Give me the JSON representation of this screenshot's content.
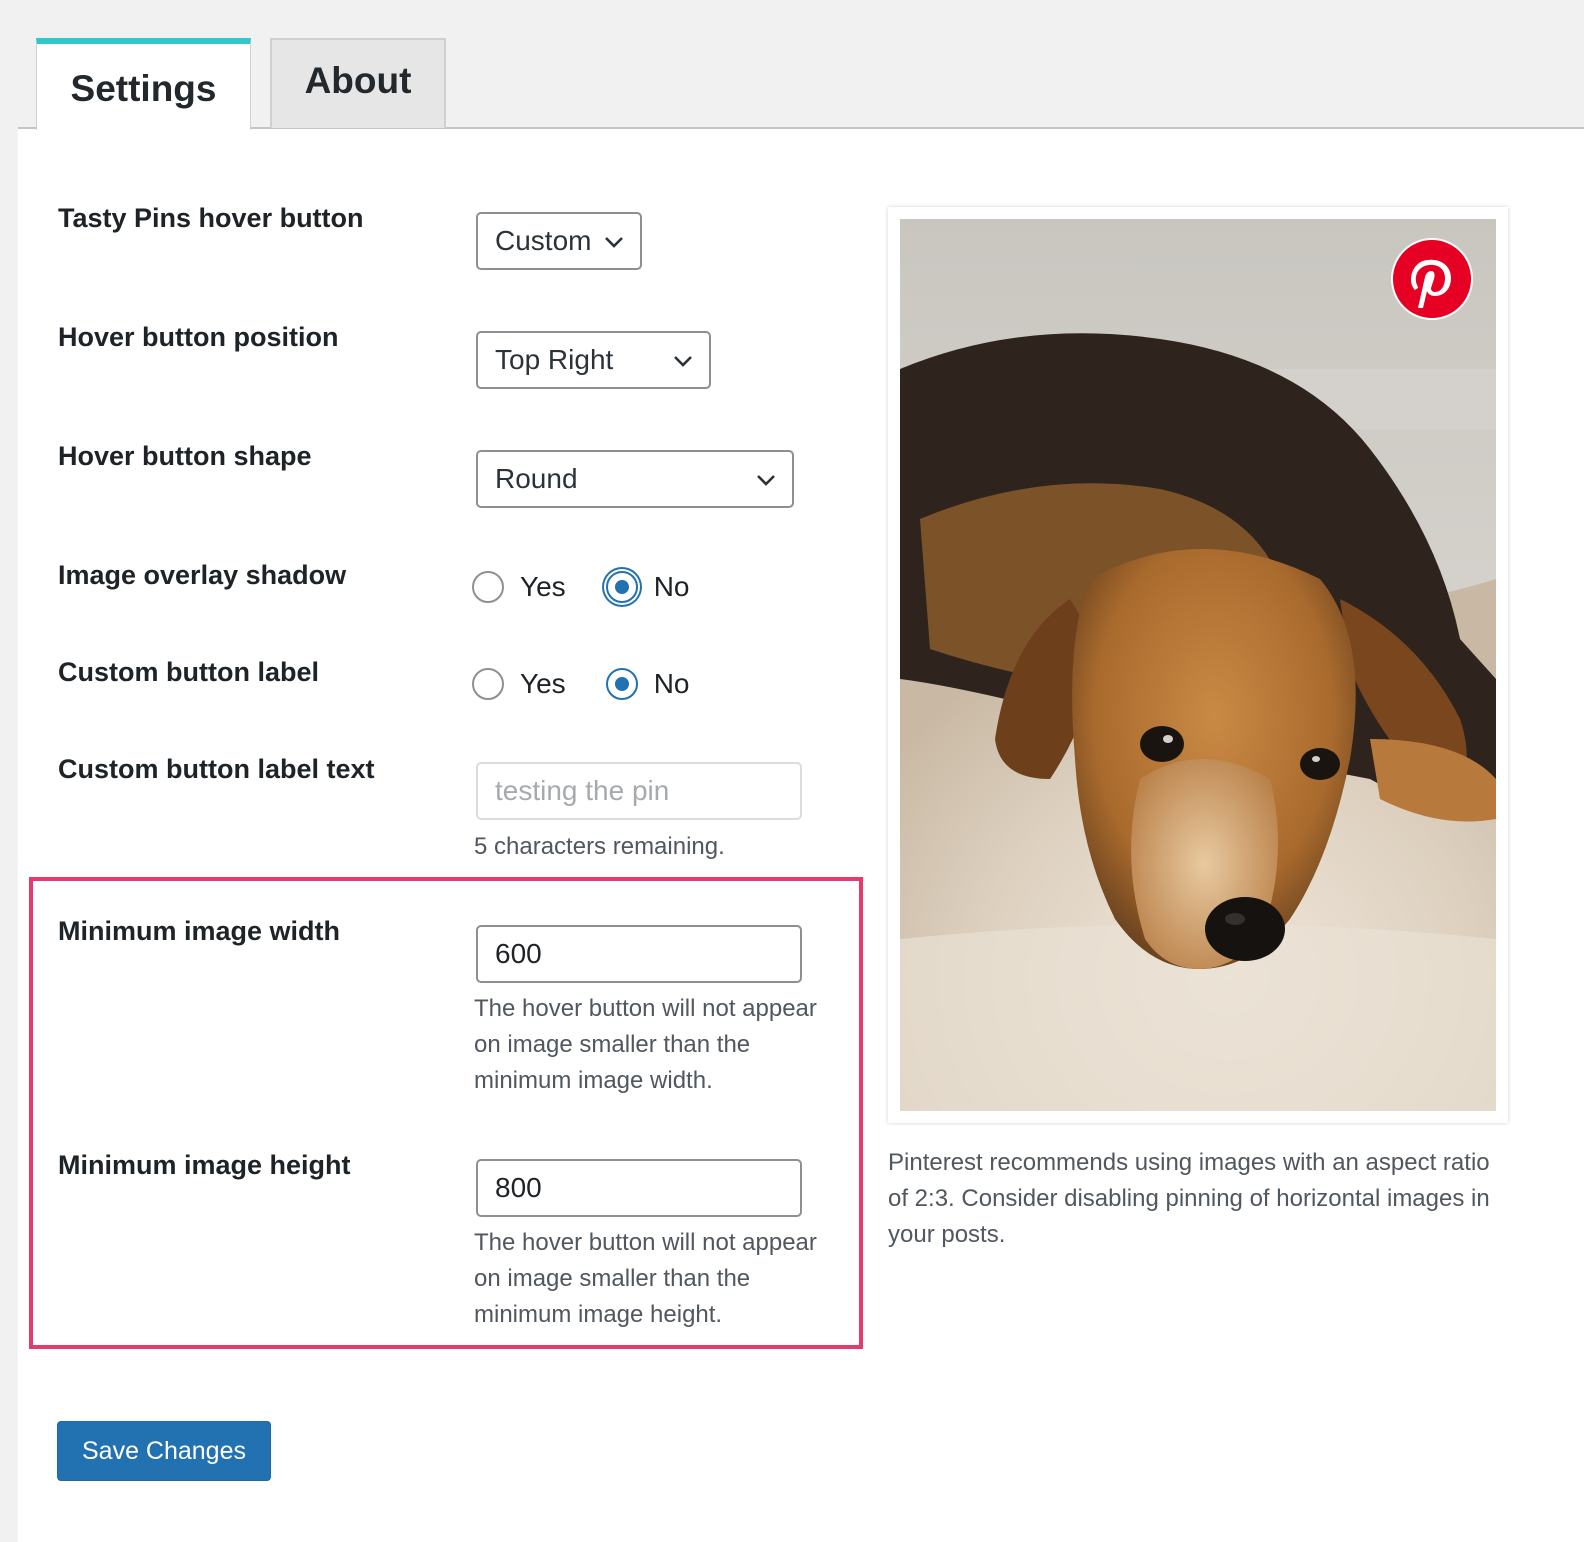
{
  "tabs": [
    {
      "label": "Settings",
      "active": true
    },
    {
      "label": "About",
      "active": false
    }
  ],
  "settings": {
    "hover_button": {
      "label": "Tasty Pins hover button",
      "value": "Custom"
    },
    "position": {
      "label": "Hover button position",
      "value": "Top Right"
    },
    "shape": {
      "label": "Hover button shape",
      "value": "Round"
    },
    "overlay_shadow": {
      "label": "Image overlay shadow",
      "yes": "Yes",
      "no": "No",
      "selected": "No"
    },
    "custom_label": {
      "label": "Custom button label",
      "yes": "Yes",
      "no": "No",
      "selected": "No"
    },
    "custom_label_text": {
      "label": "Custom button label text",
      "placeholder": "testing the pin",
      "remaining": "5 characters remaining."
    },
    "min_width": {
      "label": "Minimum image width",
      "value": "600",
      "help": "The hover button will not appear on image smaller than the minimum image width."
    },
    "min_height": {
      "label": "Minimum image height",
      "value": "800",
      "help": "The hover button will not appear on image smaller than the minimum image height."
    }
  },
  "save_label": "Save Changes",
  "preview": {
    "caption": "Pinterest recommends using images with an aspect ratio of 2:3. Consider disabling pinning of horizontal images in your posts.",
    "image_subject": "dog lying on a rug",
    "badge_icon": "pinterest-icon"
  },
  "colors": {
    "tab_accent": "#2fc8c9",
    "primary": "#2271b1",
    "highlight_border": "#e63a6e",
    "pinterest_red": "#e60023"
  }
}
